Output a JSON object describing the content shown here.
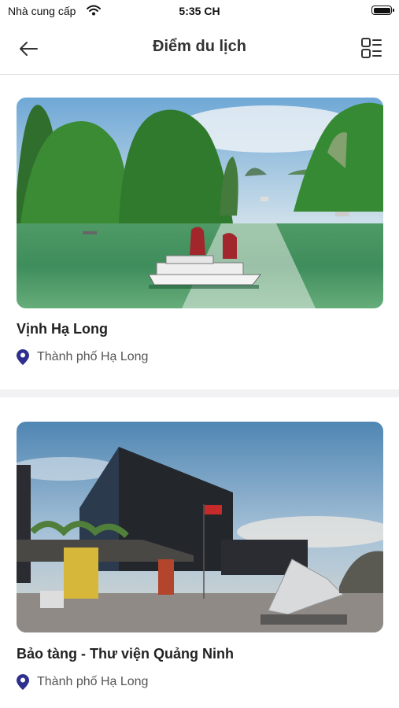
{
  "status_bar": {
    "carrier": "Nhà cung cấp",
    "time": "5:35 CH"
  },
  "header": {
    "title": "Điểm du lịch"
  },
  "places": [
    {
      "name": "Vịnh Hạ Long",
      "location": "Thành phố Hạ Long"
    },
    {
      "name": "Bảo tàng - Thư viện Quảng Ninh",
      "location": "Thành phố Hạ Long"
    }
  ],
  "colors": {
    "location_pin": "#2f2f8f",
    "separator": "#f2f2f4",
    "divider": "#dcdcdc"
  },
  "icons": {
    "back": "arrow-left-icon",
    "view": "grid-list-icon",
    "location": "map-pin-icon",
    "wifi": "wifi-icon",
    "battery": "battery-icon"
  }
}
